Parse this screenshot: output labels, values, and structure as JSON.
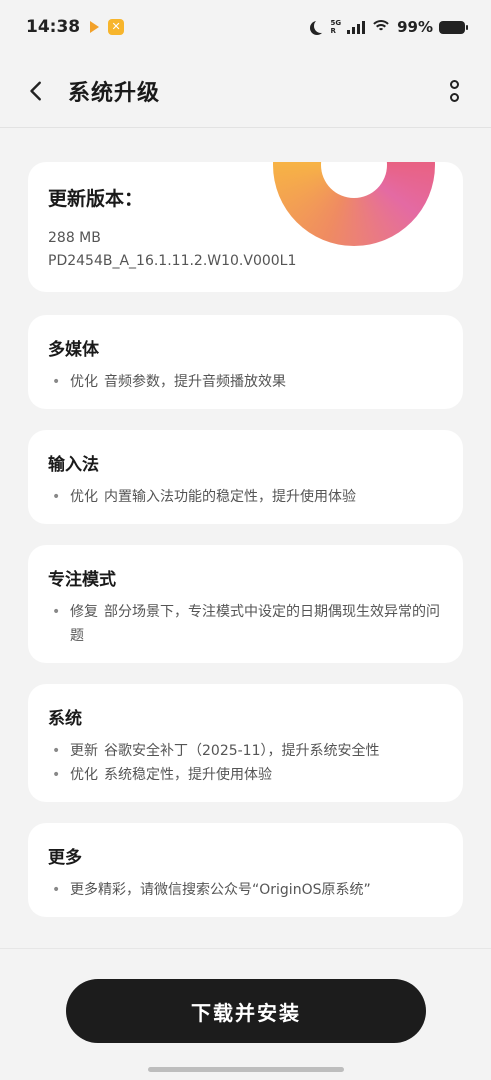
{
  "status_bar": {
    "time": "14:38",
    "network_label_top": "5G",
    "network_label_bottom": "R",
    "battery": "99%"
  },
  "header": {
    "title": "系统升级"
  },
  "version": {
    "heading": "更新版本：",
    "size": "288 MB",
    "build": "PD2454B_A_16.1.11.2.W10.V000L1"
  },
  "sections": [
    {
      "title": "多媒体",
      "items": [
        {
          "tag": "优化",
          "text": "音频参数，提升音频播放效果"
        }
      ]
    },
    {
      "title": "输入法",
      "items": [
        {
          "tag": "优化",
          "text": "内置输入法功能的稳定性，提升使用体验"
        }
      ]
    },
    {
      "title": "专注模式",
      "items": [
        {
          "tag": "修复",
          "text": "部分场景下，专注模式中设定的日期偶现生效异常的问题"
        }
      ]
    },
    {
      "title": "系统",
      "items": [
        {
          "tag": "更新",
          "text": "谷歌安全补丁（2025-11），提升系统安全性"
        },
        {
          "tag": "优化",
          "text": "系统稳定性，提升使用体验"
        }
      ]
    },
    {
      "title": "更多",
      "items": [
        {
          "tag": "",
          "text": "更多精彩，请微信搜索公众号“OriginOS原系统”"
        }
      ]
    }
  ],
  "actions": {
    "install_label": "下载并安装"
  },
  "colors": {
    "button_bg": "#1c1c1c",
    "page_bg": "#f3f3f3",
    "ring_accent": "#ef8b62"
  }
}
